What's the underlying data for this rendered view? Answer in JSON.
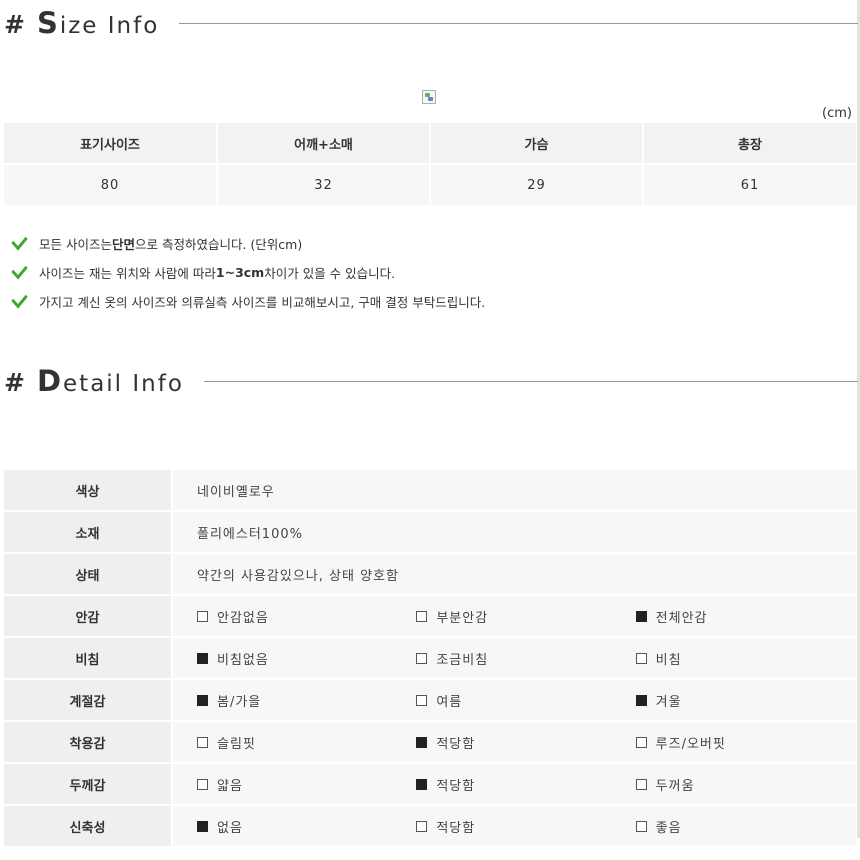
{
  "size_section": {
    "hash": "#",
    "title_cap": "S",
    "title_rest": "ize Info",
    "unit": "(cm)",
    "headers": [
      "표기사이즈",
      "어깨+소매",
      "가슴",
      "총장"
    ],
    "row": [
      "80",
      "32",
      "29",
      "61"
    ]
  },
  "notes": [
    {
      "pre": "모든 사이즈는 ",
      "bold": "단면",
      "post": " 으로 측정하였습니다. (단위cm)"
    },
    {
      "pre": "사이즈는 재는 위치와 사람에 따라 ",
      "bold": "1~3cm",
      "post": "차이가 있을 수 있습니다."
    },
    {
      "pre": "가지고 계신 옷의 사이즈와 의류실측 사이즈를 비교해보시고, 구매 결정 부탁드립니다.",
      "bold": "",
      "post": ""
    }
  ],
  "detail_section": {
    "hash": "#",
    "title_cap": "D",
    "title_rest": "etail Info",
    "rows": [
      {
        "label": "색상",
        "value": "네이비옐로우"
      },
      {
        "label": "소재",
        "value": "폴리에스터100%"
      },
      {
        "label": "상태",
        "value": "약간의 사용감있으나, 상태 양호함"
      },
      {
        "label": "안감",
        "options": [
          {
            "text": "안감없음",
            "checked": false
          },
          {
            "text": "부분안감",
            "checked": false
          },
          {
            "text": "전체안감",
            "checked": true
          }
        ]
      },
      {
        "label": "비침",
        "options": [
          {
            "text": "비침없음",
            "checked": true
          },
          {
            "text": "조금비침",
            "checked": false
          },
          {
            "text": "비침",
            "checked": false
          }
        ]
      },
      {
        "label": "계절감",
        "options": [
          {
            "text": "봄/가을",
            "checked": true
          },
          {
            "text": "여름",
            "checked": false
          },
          {
            "text": "겨울",
            "checked": true
          }
        ]
      },
      {
        "label": "착용감",
        "options": [
          {
            "text": "슬림핏",
            "checked": false
          },
          {
            "text": "적당함",
            "checked": true
          },
          {
            "text": "루즈/오버핏",
            "checked": false
          }
        ]
      },
      {
        "label": "두께감",
        "options": [
          {
            "text": "얇음",
            "checked": false
          },
          {
            "text": "적당함",
            "checked": true
          },
          {
            "text": "두꺼움",
            "checked": false
          }
        ]
      },
      {
        "label": "신축성",
        "options": [
          {
            "text": "없음",
            "checked": true
          },
          {
            "text": "적당함",
            "checked": false
          },
          {
            "text": "좋음",
            "checked": false
          }
        ]
      }
    ]
  },
  "colors": {
    "check": "#3cab2a",
    "label_bg": "#efefef",
    "value_bg": "#f7f7f7"
  }
}
